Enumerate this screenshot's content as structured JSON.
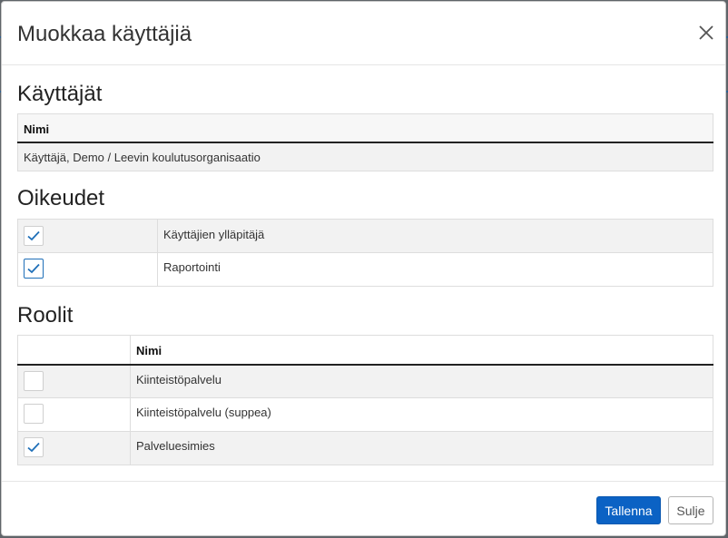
{
  "modal": {
    "title": "Muokkaa käyttäjiä",
    "close_icon": "close-icon"
  },
  "users_section": {
    "title": "Käyttäjät",
    "header": "Nimi",
    "rows": [
      "Käyttäjä, Demo / Leevin koulutusorganisaatio"
    ]
  },
  "permissions_section": {
    "title": "Oikeudet",
    "rows": [
      {
        "label": "Käyttäjien ylläpitäjä",
        "checked": true
      },
      {
        "label": "Raportointi",
        "checked": true
      }
    ]
  },
  "roles_section": {
    "title": "Roolit",
    "header": "Nimi",
    "rows": [
      {
        "label": "Kiinteistöpalvelu",
        "checked": false
      },
      {
        "label": "Kiinteistöpalvelu (suppea)",
        "checked": false
      },
      {
        "label": "Palveluesimies",
        "checked": true
      }
    ]
  },
  "footer": {
    "save_label": "Tallenna",
    "close_label": "Sulje"
  },
  "colors": {
    "primary": "#0b62c4",
    "check": "#1f6fb8",
    "stripe": "#f2f2f2"
  }
}
